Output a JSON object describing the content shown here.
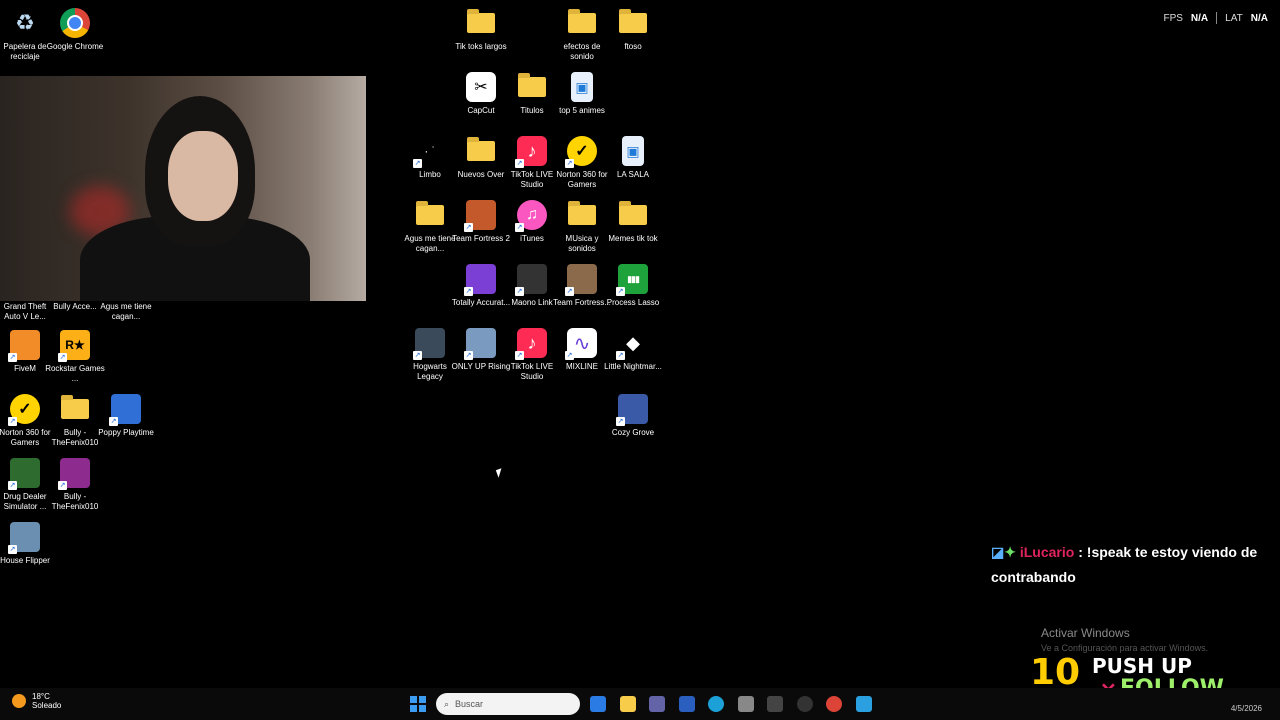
{
  "desktop_icons": [
    {
      "label": "Papelera de reciclaje",
      "icon": "recycle-bin-icon",
      "color": "#cfe3f7",
      "type": "app"
    },
    {
      "label": "Google Chrome",
      "icon": "chrome-icon",
      "color": "#db4437",
      "type": "app"
    },
    {
      "label": "Grand Theft Auto V Le...",
      "icon": "gta-icon",
      "color": "#2e7d32",
      "type": "app"
    },
    {
      "label": "Bully Acce...",
      "icon": "bully-icon",
      "color": "#888888",
      "type": "app"
    },
    {
      "label": "Agus me tiene cagan...",
      "icon": "folder-icon",
      "color": "#f7cc4a",
      "type": "folder"
    },
    {
      "label": "FiveM",
      "icon": "fivem-icon",
      "color": "#f28c28",
      "type": "app"
    },
    {
      "label": "Rockstar Games ...",
      "icon": "rockstar-icon",
      "color": "#fcaf17",
      "type": "app"
    },
    {
      "label": "Norton 360 for Gamers",
      "icon": "norton-icon",
      "color": "#ffd400",
      "type": "app"
    },
    {
      "label": "Bully - TheFenix010",
      "icon": "folder-icon",
      "color": "#f7cc4a",
      "type": "folder"
    },
    {
      "label": "Poppy Playtime",
      "icon": "poppy-icon",
      "color": "#2f6fd6",
      "type": "app"
    },
    {
      "label": "Drug Dealer Simulator ...",
      "icon": "drug-dealer-icon",
      "color": "#2e6b2e",
      "type": "app"
    },
    {
      "label": "Bully - TheFenix010",
      "icon": "winrar-icon",
      "color": "#8e2b8e",
      "type": "app"
    },
    {
      "label": "House Flipper",
      "icon": "house-flipper-icon",
      "color": "#6a8fb0",
      "type": "app"
    },
    {
      "label": "Tik toks largos",
      "icon": "folder-icon",
      "color": "#f7cc4a",
      "type": "folder"
    },
    {
      "label": "efectos de sonido",
      "icon": "folder-icon",
      "color": "#f7cc4a",
      "type": "folder"
    },
    {
      "label": "ftoso",
      "icon": "folder-icon",
      "color": "#f7cc4a",
      "type": "folder"
    },
    {
      "label": "CapCut",
      "icon": "capcut-icon",
      "color": "#ffffff",
      "type": "app"
    },
    {
      "label": "Titulos",
      "icon": "folder-icon",
      "color": "#f7cc4a",
      "type": "folder"
    },
    {
      "label": "top 5 animes",
      "icon": "image-file-icon",
      "color": "#e8f1fb",
      "type": "app"
    },
    {
      "label": "Limbo",
      "icon": "limbo-icon",
      "color": "#000000",
      "type": "app"
    },
    {
      "label": "Nuevos Over",
      "icon": "folder-icon",
      "color": "#f7cc4a",
      "type": "folder"
    },
    {
      "label": "TikTok LIVE Studio",
      "icon": "tiktok-live-icon",
      "color": "#fe2c55",
      "type": "app"
    },
    {
      "label": "Norton 360 for Gamers",
      "icon": "norton-icon",
      "color": "#ffd400",
      "type": "app"
    },
    {
      "label": "LA SALA",
      "icon": "image-file-icon",
      "color": "#e8f1fb",
      "type": "app"
    },
    {
      "label": "Agus me tiene cagan...",
      "icon": "folder-icon",
      "color": "#f7cc4a",
      "type": "folder"
    },
    {
      "label": "Team Fortress 2",
      "icon": "tf2-icon",
      "color": "#c45a2c",
      "type": "app"
    },
    {
      "label": "iTunes",
      "icon": "itunes-icon",
      "color": "#fa57c1",
      "type": "app"
    },
    {
      "label": "MUsica y sonidos",
      "icon": "folder-icon",
      "color": "#f7cc4a",
      "type": "folder"
    },
    {
      "label": "Memes tik tok",
      "icon": "folder-icon",
      "color": "#f7cc4a",
      "type": "folder"
    },
    {
      "label": "Totally Accurat...",
      "icon": "tabs-icon",
      "color": "#7b3fd6",
      "type": "app"
    },
    {
      "label": "Maono Link",
      "icon": "maono-icon",
      "color": "#333333",
      "type": "app"
    },
    {
      "label": "Team Fortress...",
      "icon": "tf2-icon",
      "color": "#8a6a4a",
      "type": "app"
    },
    {
      "label": "Process Lasso",
      "icon": "process-lasso-icon",
      "color": "#1ea33c",
      "type": "app"
    },
    {
      "label": "Hogwarts Legacy",
      "icon": "hogwarts-icon",
      "color": "#3a4a5a",
      "type": "app"
    },
    {
      "label": "ONLY UP Rising",
      "icon": "only-up-icon",
      "color": "#7a9ac0",
      "type": "app"
    },
    {
      "label": "TikTok LIVE Studio",
      "icon": "tiktok-live-icon",
      "color": "#fe2c55",
      "type": "app"
    },
    {
      "label": "MIXLINE",
      "icon": "mixline-icon",
      "color": "#ffffff",
      "type": "app"
    },
    {
      "label": "Little Nightmar...",
      "icon": "little-nightmares-icon",
      "color": "#222222",
      "type": "app"
    },
    {
      "label": "Cozy Grove",
      "icon": "cozy-grove-icon",
      "color": "#3a5aa8",
      "type": "app"
    }
  ],
  "hud": {
    "fps_label": "FPS",
    "fps_value": "N/A",
    "lat_label": "LAT",
    "lat_value": "N/A"
  },
  "chat": {
    "username": "iLucario",
    "separator": ":",
    "message": "!speak te estoy viendo de contrabando"
  },
  "watermark": {
    "title": "Activar Windows",
    "subtitle": "Ve a Configuración para activar Windows."
  },
  "banner": {
    "number": "10",
    "line1": "PUSH UP",
    "line2": "FOLLOW",
    "x_mark": "✕"
  },
  "taskbar": {
    "weather_temp": "18°C",
    "weather_desc": "Soleado",
    "search_placeholder": "Buscar",
    "date": "4/5/2026",
    "apps": [
      "store-icon",
      "file-explorer-icon",
      "teams-icon",
      "mail-icon",
      "edge-icon",
      "settings-icon",
      "terminal-icon",
      "obs-icon",
      "chrome-icon",
      "photos-icon"
    ]
  }
}
